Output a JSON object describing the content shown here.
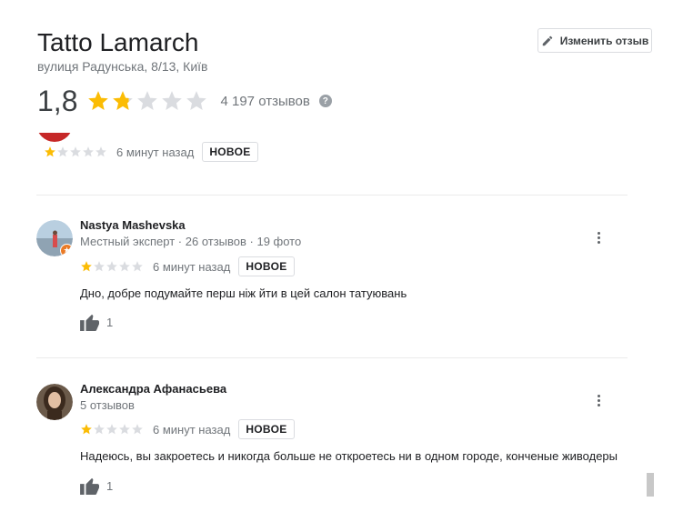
{
  "place": {
    "title": "Tatto Lamarch",
    "address": "вулиця Радунська, 8/13, Київ",
    "rating": "1,8",
    "review_count": "4 197 отзывов",
    "help_icon": "?"
  },
  "edit_button": {
    "label": "Изменить отзыв",
    "icon": "pencil-icon"
  },
  "colors": {
    "star_filled": "#fbbc04",
    "star_empty": "#dadce0",
    "accent_red": "#c62828"
  },
  "partial_review": {
    "stars": 1,
    "time": "6 минут назад",
    "badge": "НОВОЕ"
  },
  "reviews": [
    {
      "name": "Nastya Mashevska",
      "meta": "Местный эксперт · 26 отзывов · 19 фото",
      "stars": 1,
      "time": "6 минут назад",
      "badge": "НОВОЕ",
      "text": "Дно, добре подумайте перш ніж йти в цей салон татуювань",
      "likes": "1"
    },
    {
      "name": "Александра Афанасьева",
      "meta": "5 отзывов",
      "stars": 1,
      "time": "6 минут назад",
      "badge": "НОВОЕ",
      "text": "Надеюсь, вы закроетесь и никогда больше не откроетесь ни в одном городе, конченые живодеры",
      "likes": "1"
    }
  ]
}
